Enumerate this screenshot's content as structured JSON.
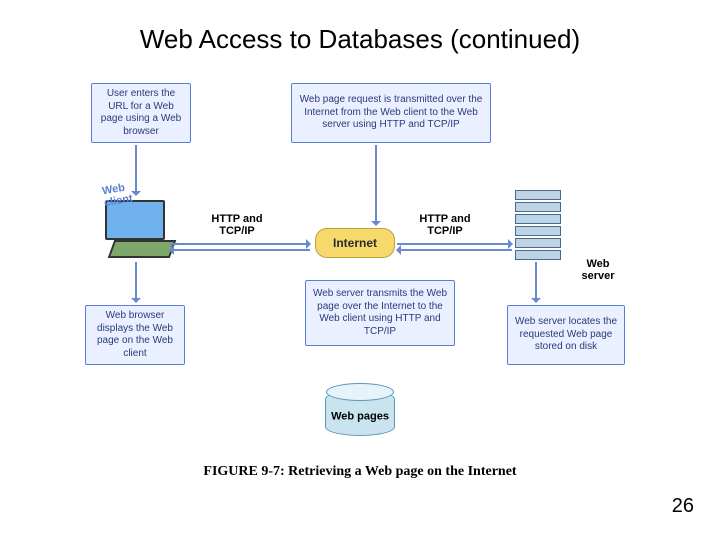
{
  "title": "Web Access to Databases (continued)",
  "figure_caption": "FIGURE 9-7: Retrieving a Web page on the Internet",
  "page_number": "26",
  "diagram": {
    "web_client_label": "Web\nclient",
    "web_server_label": "Web\nserver",
    "internet_label": "Internet",
    "web_pages_label": "Web pages",
    "protocol_label_left": "HTTP and\nTCP/IP",
    "protocol_label_right": "HTTP and\nTCP/IP",
    "box1": "User enters the\nURL for a Web\npage using a\nWeb browser",
    "box2": "Web page request\nis transmitted over the Internet from\nthe Web client to the Web server\nusing HTTP and TCP/IP",
    "box3": "Web server\ntransmits the Web page\nover the Internet to the\nWeb client using\nHTTP and TCP/IP",
    "box4": "Web browser\ndisplays the Web\npage on the\nWeb client",
    "box5": "Web server locates\nthe requested Web\npage stored\non disk"
  }
}
